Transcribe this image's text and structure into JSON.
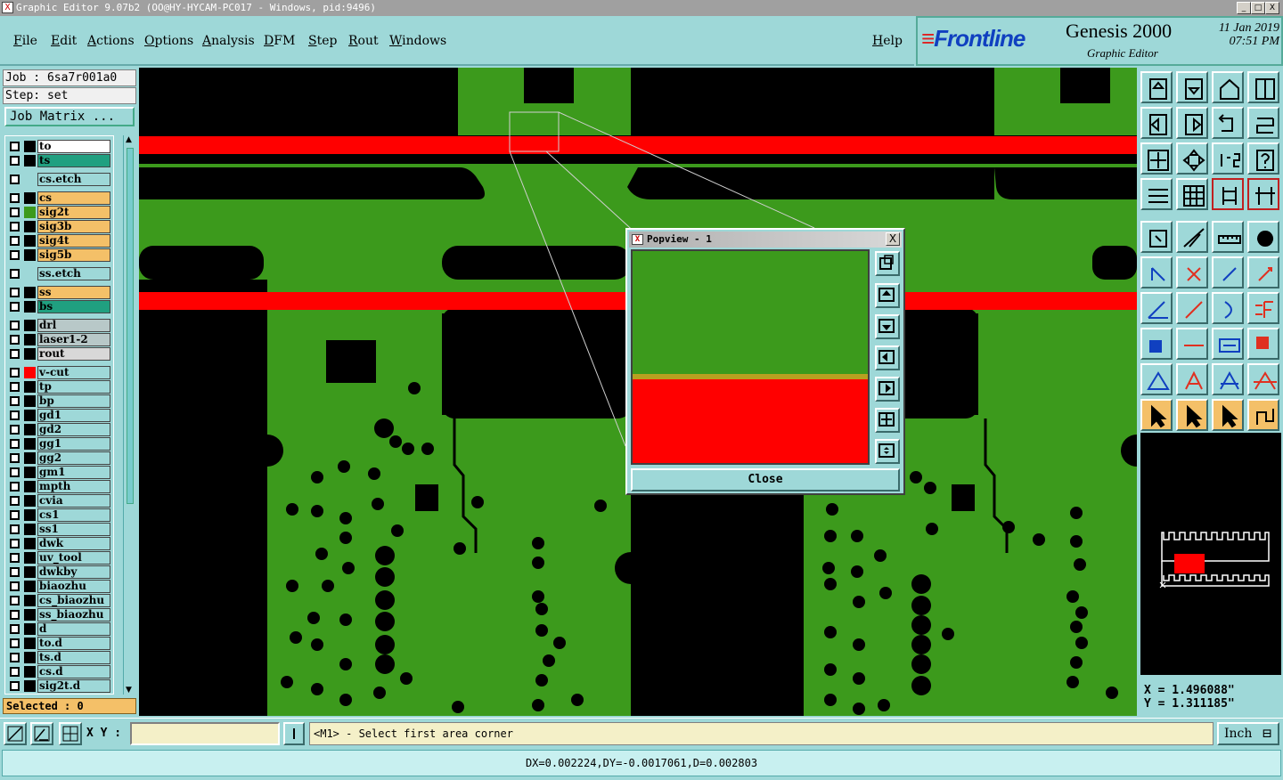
{
  "window": {
    "title": "Graphic Editor 9.07b2 (OO@HY-HYCAM-PC017 - Windows, pid:9496)",
    "controls": [
      "_",
      "□",
      "X"
    ]
  },
  "menu": {
    "items": [
      "File",
      "Edit",
      "Actions",
      "Options",
      "Analysis",
      "DFM",
      "Step",
      "Rout",
      "Windows"
    ],
    "help": "Help"
  },
  "brand": {
    "logo": "Frontline",
    "product": "Genesis 2000",
    "subtitle": "Graphic Editor",
    "date": "11 Jan 2019",
    "time": "07:51 PM"
  },
  "job": {
    "job_label": "Job : 6sa7r001a0",
    "step_label": "Step: set",
    "matrix_button": "Job Matrix ..."
  },
  "layers": [
    {
      "name": "to",
      "color": "#ffffff",
      "swatch": "#000000"
    },
    {
      "name": "ts",
      "color": "#20a080",
      "swatch": "#000000"
    },
    {
      "name": "cs.etch",
      "color": "#9ed8d8",
      "swatch": "#9ed8d8"
    },
    {
      "name": "cs",
      "color": "#f4c068",
      "swatch": "#000000"
    },
    {
      "name": "sig2t",
      "color": "#f4c068",
      "swatch": "#3c9a1c"
    },
    {
      "name": "sig3b",
      "color": "#f4c068",
      "swatch": "#000000"
    },
    {
      "name": "sig4t",
      "color": "#f4c068",
      "swatch": "#000000"
    },
    {
      "name": "sig5b",
      "color": "#f4c068",
      "swatch": "#000000"
    },
    {
      "name": "ss.etch",
      "color": "#9ed8d8",
      "swatch": "#9ed8d8"
    },
    {
      "name": "ss",
      "color": "#f4c068",
      "swatch": "#000000"
    },
    {
      "name": "bs",
      "color": "#20a080",
      "swatch": "#000000"
    },
    {
      "name": "drl",
      "color": "#b8c8c8",
      "swatch": "#000000"
    },
    {
      "name": "laser1-2",
      "color": "#b8c8c8",
      "swatch": "#000000"
    },
    {
      "name": "rout",
      "color": "#d8d8d8",
      "swatch": "#000000"
    },
    {
      "name": "v-cut",
      "color": "#9ed8d8",
      "swatch": "#ff0000"
    },
    {
      "name": "tp",
      "color": "#9ed8d8",
      "swatch": "#000000"
    },
    {
      "name": "bp",
      "color": "#9ed8d8",
      "swatch": "#000000"
    },
    {
      "name": "gd1",
      "color": "#9ed8d8",
      "swatch": "#000000"
    },
    {
      "name": "gd2",
      "color": "#9ed8d8",
      "swatch": "#000000"
    },
    {
      "name": "gg1",
      "color": "#9ed8d8",
      "swatch": "#000000"
    },
    {
      "name": "gg2",
      "color": "#9ed8d8",
      "swatch": "#000000"
    },
    {
      "name": "gm1",
      "color": "#9ed8d8",
      "swatch": "#000000"
    },
    {
      "name": "mpth",
      "color": "#9ed8d8",
      "swatch": "#000000"
    },
    {
      "name": "cvia",
      "color": "#9ed8d8",
      "swatch": "#000000"
    },
    {
      "name": "cs1",
      "color": "#9ed8d8",
      "swatch": "#000000"
    },
    {
      "name": "ss1",
      "color": "#9ed8d8",
      "swatch": "#000000"
    },
    {
      "name": "dwk",
      "color": "#9ed8d8",
      "swatch": "#000000"
    },
    {
      "name": "uv_tool",
      "color": "#9ed8d8",
      "swatch": "#000000"
    },
    {
      "name": "dwkby",
      "color": "#9ed8d8",
      "swatch": "#000000"
    },
    {
      "name": "biaozhu",
      "color": "#9ed8d8",
      "swatch": "#000000"
    },
    {
      "name": "cs_biaozhu",
      "color": "#9ed8d8",
      "swatch": "#000000"
    },
    {
      "name": "ss_biaozhu",
      "color": "#9ed8d8",
      "swatch": "#000000"
    },
    {
      "name": "d",
      "color": "#9ed8d8",
      "swatch": "#000000"
    },
    {
      "name": "to.d",
      "color": "#9ed8d8",
      "swatch": "#000000"
    },
    {
      "name": "ts.d",
      "color": "#9ed8d8",
      "swatch": "#000000"
    },
    {
      "name": "cs.d",
      "color": "#9ed8d8",
      "swatch": "#000000"
    },
    {
      "name": "sig2t.d",
      "color": "#9ed8d8",
      "swatch": "#000000"
    }
  ],
  "selected_label": "Selected : 0",
  "toolbar": {
    "xy_label": "X Y :",
    "xy_value": "",
    "prompt": "<M1> - Select first area corner",
    "unit": "Inch"
  },
  "status": "DX=0.002224,DY=-0.0017061,D=0.002803",
  "coords": {
    "x": "X = 1.496088\"",
    "y": "Y = 1.311185\""
  },
  "popview": {
    "title": "Popview - 1",
    "close_label": "Close",
    "close_x": "X"
  },
  "colors": {
    "copper": "#3c9a1c",
    "vcut": "#ff0000",
    "background": "#000000",
    "ui": "#9ed8d8"
  }
}
